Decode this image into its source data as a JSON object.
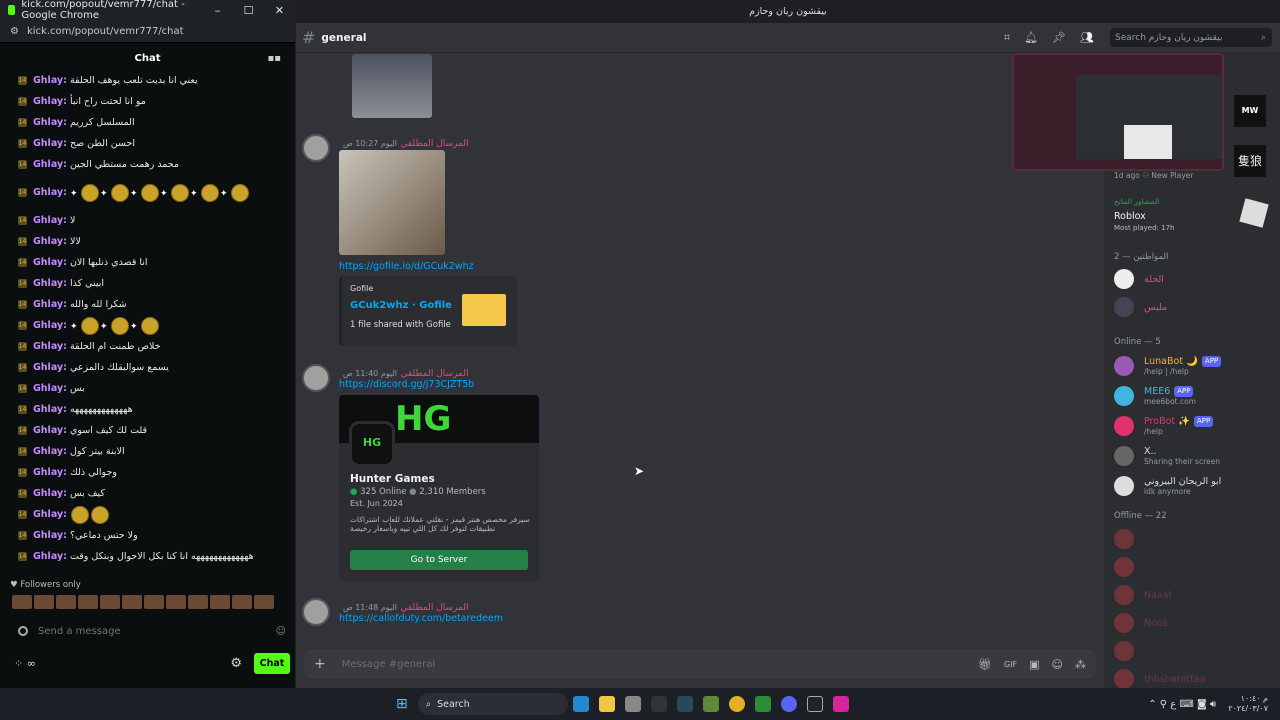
{
  "kick": {
    "window_title": "kick.com/popout/vemr777/chat - Google Chrome",
    "url": "kick.com/popout/vemr777/chat",
    "chat_header": "Chat",
    "username": "Ghlay",
    "messages": [
      "يعني انا بديت تلعب يوهف الحلقة",
      "مو انا لحتت راح انبأ",
      "المسلسل كرريم",
      "احسن الطن صح",
      "محمد رهمت مستطي الجين",
      "",
      "لا",
      "لالا",
      "انا قصدي ذنلبها الان",
      "ابيني كذا",
      "شكرا لله والله",
      "",
      "خلاص طمنت ام الحلقة",
      "يسمع سوالبقلك دالمزعي",
      "بس",
      "هههههههههههههه",
      "قلت لك كيف اسوي",
      "الابنة بيتر كول",
      "وجوالي ذلك",
      "كيف بس",
      "",
      "ولا حتس دماعي؟",
      "هههههههههههههه انا كنا بكل الاحوال وبتكل وقت"
    ],
    "followers_only": "Followers only",
    "send_placeholder": "Send a message",
    "chat_button": "Chat"
  },
  "discord": {
    "window_title": "بيقشون ريان وحازم",
    "channel": "general",
    "search_placeholder": "Search بيقشون ريان وحازم",
    "msg1_author": "المرسال المطلقي",
    "msg1_time": "اليوم 10:27 ص",
    "msg1_link": "https://gofile.io/d/GCuk2whz",
    "gofile_site": "Gofile",
    "gofile_title": "GCuk2whz · Gofile",
    "gofile_desc": "1 file shared with Gofile",
    "msg2_author": "المرسال المطلقي",
    "msg2_time": "اليوم 11:40 ص",
    "msg2_link": "https://discord.gg/j73CJZT5b",
    "invite_name": "Hunter Games",
    "invite_online": "325 Online",
    "invite_members": "2,310 Members",
    "invite_est": "Est. Jun 2024",
    "invite_desc": "سيرفر مخصص هنتر قيمز - نقلتي عملاتك للعاب اشتراكات تطبيقات لتوفر لك كل اللي تبيه وبأسعار رخيصة",
    "go_server": "Go to Server",
    "msg3_author": "المرسال المطلقي",
    "msg3_time": "اليوم 11:48 ص",
    "msg3_link": "https://callofduty.com/betaredeem",
    "compose_placeholder": "Message #general",
    "activity_time": "1d ago",
    "activity_player": "New Player",
    "roblox_title": "Roblox",
    "roblox_played": "Most played: 17h",
    "roblox_user": "المشاور الماتح",
    "sec_role": "المواطنين — 2",
    "role_m1": "الحلة",
    "role_m2": "ملبس",
    "sec_online": "Online — 5",
    "online": [
      {
        "name": "LunaBot 🌙",
        "sub": "/help | /help",
        "app": "APP"
      },
      {
        "name": "MEE6",
        "sub": "mee6bot.com",
        "app": "APP"
      },
      {
        "name": "ProBot ✨",
        "sub": "/help",
        "app": "APP"
      },
      {
        "name": "X..",
        "sub": "Sharing their screen",
        "app": ""
      },
      {
        "name": "ابو الريحان البيروني",
        "sub": "idk anymore",
        "app": ""
      }
    ],
    "sec_offline": "Offline — 22",
    "offline": [
      "",
      "",
      "Naaal",
      "Noos",
      "",
      "thbsharattaa"
    ]
  },
  "taskbar": {
    "search": "Search",
    "time": "م ١٠:٤٠",
    "date": "٢٠٢٤/٠٣/٠٧"
  }
}
